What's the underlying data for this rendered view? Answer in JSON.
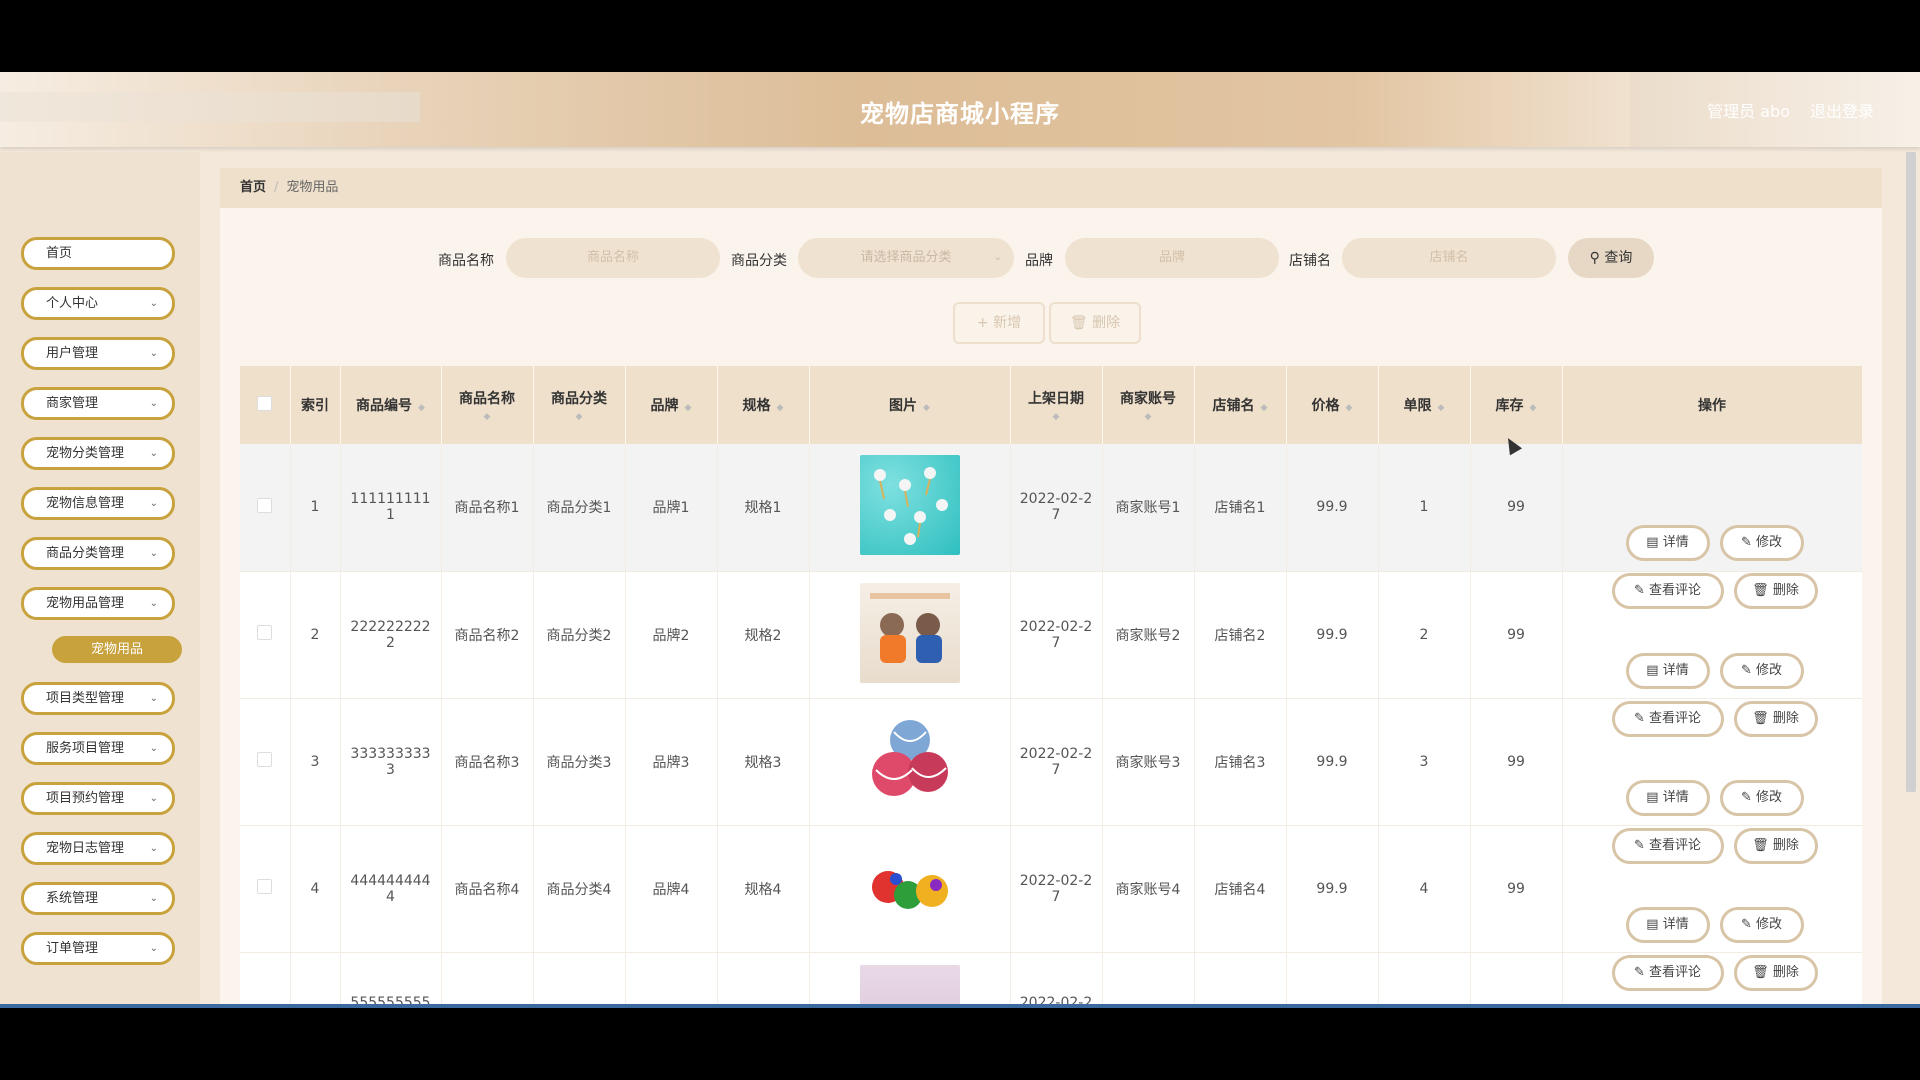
{
  "header": {
    "title": "宠物店商城小程序",
    "user": "管理员 abo",
    "logout": "退出登录"
  },
  "sidebar": {
    "items": [
      {
        "label": "首页",
        "expandable": false
      },
      {
        "label": "个人中心",
        "expandable": true
      },
      {
        "label": "用户管理",
        "expandable": true
      },
      {
        "label": "商家管理",
        "expandable": true
      },
      {
        "label": "宠物分类管理",
        "expandable": true
      },
      {
        "label": "宠物信息管理",
        "expandable": true
      },
      {
        "label": "商品分类管理",
        "expandable": true
      },
      {
        "label": "宠物用品管理",
        "expandable": true
      },
      {
        "label": "宠物用品",
        "sub": true
      },
      {
        "label": "项目类型管理",
        "expandable": true
      },
      {
        "label": "服务项目管理",
        "expandable": true
      },
      {
        "label": "项目预约管理",
        "expandable": true
      },
      {
        "label": "宠物日志管理",
        "expandable": true
      },
      {
        "label": "系统管理",
        "expandable": true
      },
      {
        "label": "订单管理",
        "expandable": true
      }
    ]
  },
  "breadcrumb": {
    "home": "首页",
    "current": "宠物用品"
  },
  "search": {
    "name_label": "商品名称",
    "name_placeholder": "商品名称",
    "category_label": "商品分类",
    "category_placeholder": "请选择商品分类",
    "brand_label": "品牌",
    "brand_placeholder": "品牌",
    "shop_label": "店铺名",
    "shop_placeholder": "店铺名",
    "query_button": "查询"
  },
  "actions": {
    "add": "新增",
    "delete": "删除"
  },
  "table": {
    "headers": [
      "索引",
      "商品编号",
      "商品名称",
      "商品分类",
      "品牌",
      "规格",
      "图片",
      "上架日期",
      "商家账号",
      "店铺名",
      "价格",
      "单限",
      "库存",
      "操作"
    ],
    "ops": {
      "detail": "详情",
      "edit": "修改",
      "comment": "查看评论",
      "delete": "删除"
    },
    "rows": [
      {
        "index": "1",
        "code_a": "111111111",
        "code_b": "1",
        "name": "商品名称1",
        "category": "商品分类1",
        "brand": "品牌1",
        "spec": "规格1",
        "date_a": "2022-02-2",
        "date_b": "7",
        "merchant": "商家账号1",
        "shop": "店铺名1",
        "price": "99.9",
        "limit": "1",
        "stock": "99"
      },
      {
        "index": "2",
        "code_a": "222222222",
        "code_b": "2",
        "name": "商品名称2",
        "category": "商品分类2",
        "brand": "品牌2",
        "spec": "规格2",
        "date_a": "2022-02-2",
        "date_b": "7",
        "merchant": "商家账号2",
        "shop": "店铺名2",
        "price": "99.9",
        "limit": "2",
        "stock": "99"
      },
      {
        "index": "3",
        "code_a": "333333333",
        "code_b": "3",
        "name": "商品名称3",
        "category": "商品分类3",
        "brand": "品牌3",
        "spec": "规格3",
        "date_a": "2022-02-2",
        "date_b": "7",
        "merchant": "商家账号3",
        "shop": "店铺名3",
        "price": "99.9",
        "limit": "3",
        "stock": "99"
      },
      {
        "index": "4",
        "code_a": "444444444",
        "code_b": "4",
        "name": "商品名称4",
        "category": "商品分类4",
        "brand": "品牌4",
        "spec": "规格4",
        "date_a": "2022-02-2",
        "date_b": "7",
        "merchant": "商家账号4",
        "shop": "店铺名4",
        "price": "99.9",
        "limit": "4",
        "stock": "99"
      },
      {
        "index": "",
        "code_a": "555555555",
        "code_b": "",
        "name": "",
        "category": "",
        "brand": "",
        "spec": "",
        "date_a": "2022-02-2",
        "date_b": "",
        "merchant": "",
        "shop": "",
        "price": "",
        "limit": "",
        "stock": ""
      }
    ]
  },
  "colors": {
    "accent": "#c8a23d",
    "header_bg": "#efe0cc",
    "sidebar_bg": "#efe2d0"
  }
}
